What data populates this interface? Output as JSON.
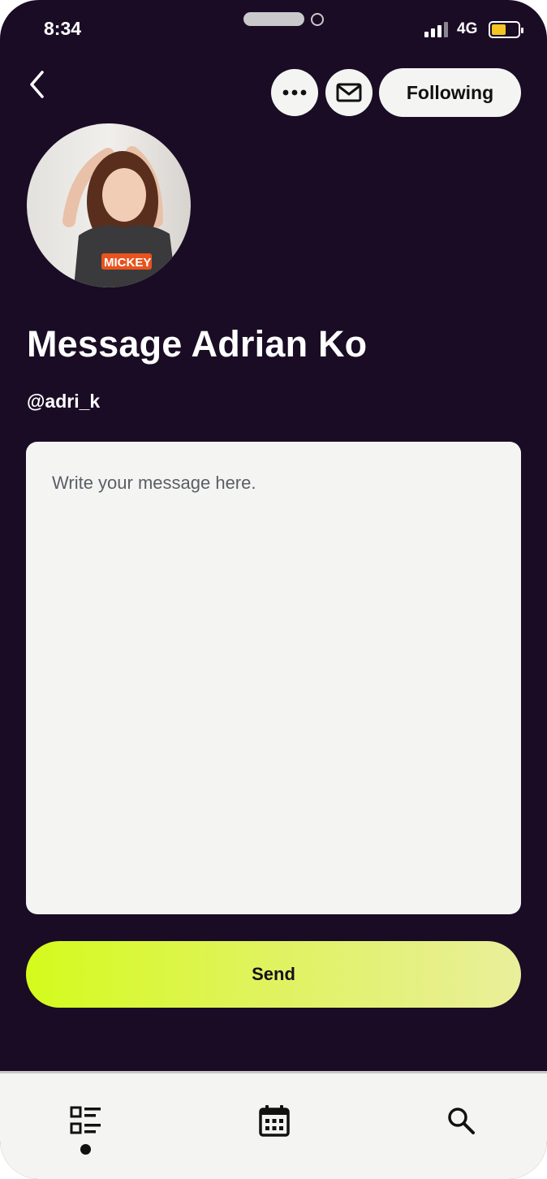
{
  "status_bar": {
    "time": "8:34",
    "network": "4G",
    "battery_level": 0.55,
    "battery_color": "#f3c623"
  },
  "header": {
    "back_icon": "chevron-left-icon",
    "more_icon": "ellipsis-icon",
    "mail_icon": "envelope-icon",
    "follow_label": "Following"
  },
  "profile": {
    "title": "Message Adrian Ko",
    "handle": "@adri_k"
  },
  "message": {
    "placeholder": "Write your message here.",
    "value": ""
  },
  "send_label": "Send",
  "bottom_nav": {
    "items": [
      {
        "icon": "list-icon",
        "active": true
      },
      {
        "icon": "calendar-icon",
        "active": false
      },
      {
        "icon": "search-icon",
        "active": false
      }
    ]
  },
  "colors": {
    "background": "#1a0c25",
    "surface": "#f4f5f3",
    "accent_start": "#d4fb1c",
    "accent_end": "#e9ef9b"
  }
}
